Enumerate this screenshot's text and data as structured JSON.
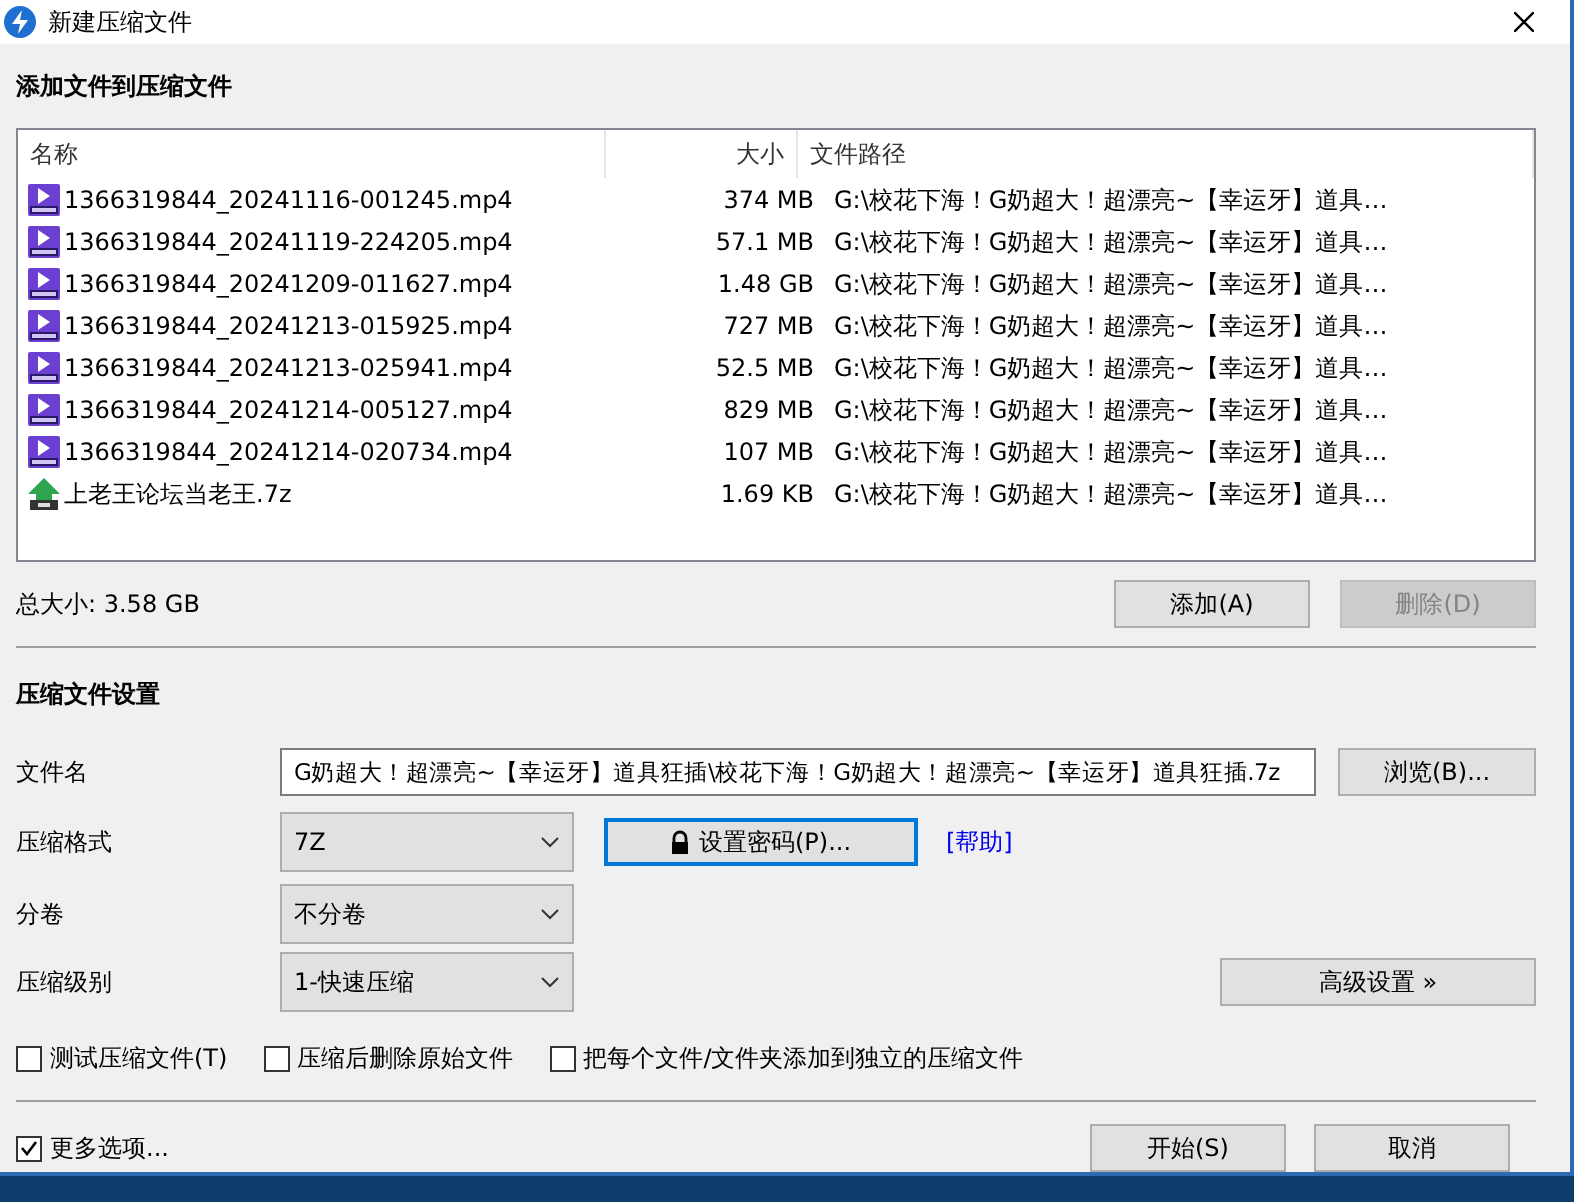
{
  "window": {
    "title": "新建压缩文件"
  },
  "add_section": {
    "heading": "添加文件到压缩文件"
  },
  "file_list": {
    "columns": [
      "名称",
      "大小",
      "文件路径"
    ],
    "rows": [
      {
        "kind": "video",
        "name": "1366319844_20241116-001245.mp4",
        "size": "374 MB",
        "path": "G:\\校花下海！G奶超大！超漂亮~【幸运牙】道具…"
      },
      {
        "kind": "video",
        "name": "1366319844_20241119-224205.mp4",
        "size": "57.1 MB",
        "path": "G:\\校花下海！G奶超大！超漂亮~【幸运牙】道具…"
      },
      {
        "kind": "video",
        "name": "1366319844_20241209-011627.mp4",
        "size": "1.48 GB",
        "path": "G:\\校花下海！G奶超大！超漂亮~【幸运牙】道具…"
      },
      {
        "kind": "video",
        "name": "1366319844_20241213-015925.mp4",
        "size": "727 MB",
        "path": "G:\\校花下海！G奶超大！超漂亮~【幸运牙】道具…"
      },
      {
        "kind": "video",
        "name": "1366319844_20241213-025941.mp4",
        "size": "52.5 MB",
        "path": "G:\\校花下海！G奶超大！超漂亮~【幸运牙】道具…"
      },
      {
        "kind": "video",
        "name": "1366319844_20241214-005127.mp4",
        "size": "829 MB",
        "path": "G:\\校花下海！G奶超大！超漂亮~【幸运牙】道具…"
      },
      {
        "kind": "video",
        "name": "1366319844_20241214-020734.mp4",
        "size": "107 MB",
        "path": "G:\\校花下海！G奶超大！超漂亮~【幸运牙】道具…"
      },
      {
        "kind": "archive",
        "name": "上老王论坛当老王.7z",
        "size": "1.69 KB",
        "path": "G:\\校花下海！G奶超大！超漂亮~【幸运牙】道具…"
      }
    ]
  },
  "total_size": "总大小: 3.58 GB",
  "list_buttons": [
    {
      "label": "添加(A)",
      "disabled": false
    },
    {
      "label": "删除(D)",
      "disabled": true
    }
  ],
  "settings": {
    "heading": "压缩文件设置",
    "filename": {
      "label": "文件名",
      "value": "G奶超大！超漂亮~【幸运牙】道具狂插\\校花下海！G奶超大！超漂亮~【幸运牙】道具狂插.7z",
      "button": "浏览(B)..."
    },
    "format": {
      "label": "压缩格式",
      "value": "7Z"
    },
    "password_button": {
      "label": "设置密码(P)...",
      "focused": true
    },
    "help_link": "[帮助]",
    "split": {
      "label": "分卷",
      "value": "不分卷"
    },
    "level": {
      "label": "压缩级别",
      "value": "1-快速压缩"
    },
    "advanced_button": "高级设置 »",
    "options": [
      {
        "label": "测试压缩文件(T)",
        "checked": false
      },
      {
        "label": "压缩后删除原始文件",
        "checked": false
      },
      {
        "label": "把每个文件/文件夹添加到独立的压缩文件",
        "checked": false
      }
    ]
  },
  "more_options": {
    "label": "更多选项...",
    "checked": true
  },
  "buttons": [
    "开始(S)",
    "取消"
  ]
}
